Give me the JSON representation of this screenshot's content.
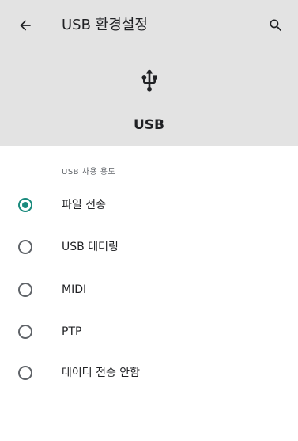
{
  "appbar": {
    "title": "USB 환경설정",
    "back_icon": "arrow-back-icon",
    "search_icon": "search-icon"
  },
  "hero": {
    "icon": "usb-icon",
    "label": "USB"
  },
  "section": {
    "label": "USB 사용 용도"
  },
  "options": [
    {
      "label": "파일 전송",
      "selected": true
    },
    {
      "label": "USB 테더링",
      "selected": false
    },
    {
      "label": "MIDI",
      "selected": false
    },
    {
      "label": "PTP",
      "selected": false
    },
    {
      "label": "데이터 전송 안함",
      "selected": false
    }
  ],
  "colors": {
    "header_bg": "#e3e3e3",
    "accent": "#1a8a7d"
  }
}
